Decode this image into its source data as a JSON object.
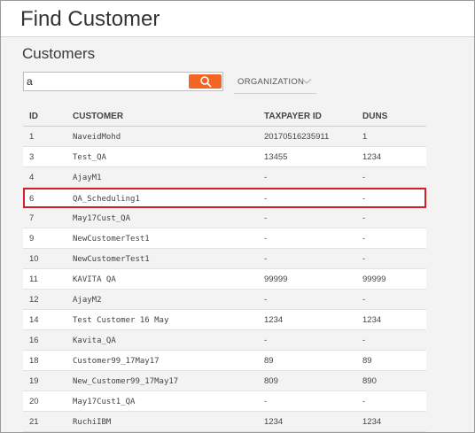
{
  "page": {
    "title": "Find Customer"
  },
  "section": {
    "title": "Customers"
  },
  "search": {
    "value": "a",
    "placeholder": ""
  },
  "filter": {
    "label": "ORGANIZATION"
  },
  "table": {
    "headers": {
      "id": "ID",
      "customer": "CUSTOMER",
      "taxpayer_id": "TAXPAYER ID",
      "duns": "DUNS"
    },
    "rows": [
      {
        "id": "1",
        "customer": "NaveidMohd",
        "taxpayer_id": "20170516235911",
        "duns": "1"
      },
      {
        "id": "3",
        "customer": "Test_QA",
        "taxpayer_id": "13455",
        "duns": "1234"
      },
      {
        "id": "4",
        "customer": "AjayM1",
        "taxpayer_id": "-",
        "duns": "-"
      },
      {
        "id": "6",
        "customer": "QA_Scheduling1",
        "taxpayer_id": "-",
        "duns": "-"
      },
      {
        "id": "7",
        "customer": "May17Cust_QA",
        "taxpayer_id": "-",
        "duns": "-"
      },
      {
        "id": "9",
        "customer": "NewCustomerTest1",
        "taxpayer_id": "-",
        "duns": "-"
      },
      {
        "id": "10",
        "customer": "NewCustomerTest1",
        "taxpayer_id": "-",
        "duns": "-"
      },
      {
        "id": "11",
        "customer": "KAVITA QA",
        "taxpayer_id": "99999",
        "duns": "99999"
      },
      {
        "id": "12",
        "customer": "AjayM2",
        "taxpayer_id": "-",
        "duns": "-"
      },
      {
        "id": "14",
        "customer": "Test Customer 16 May",
        "taxpayer_id": "1234",
        "duns": "1234"
      },
      {
        "id": "16",
        "customer": "Kavita_QA",
        "taxpayer_id": "-",
        "duns": "-"
      },
      {
        "id": "18",
        "customer": "Customer99_17May17",
        "taxpayer_id": "89",
        "duns": "89"
      },
      {
        "id": "19",
        "customer": "New_Customer99_17May17",
        "taxpayer_id": "809",
        "duns": "890"
      },
      {
        "id": "20",
        "customer": "May17Cust1_QA",
        "taxpayer_id": "-",
        "duns": "-"
      },
      {
        "id": "21",
        "customer": "RuchiIBM",
        "taxpayer_id": "1234",
        "duns": "1234"
      }
    ],
    "selected_row_index": 3
  },
  "icons": {
    "search": "search-icon",
    "dropdown": "chevron-down-icon"
  },
  "colors": {
    "accent": "#f26522",
    "highlight_border": "#d31f2a"
  }
}
